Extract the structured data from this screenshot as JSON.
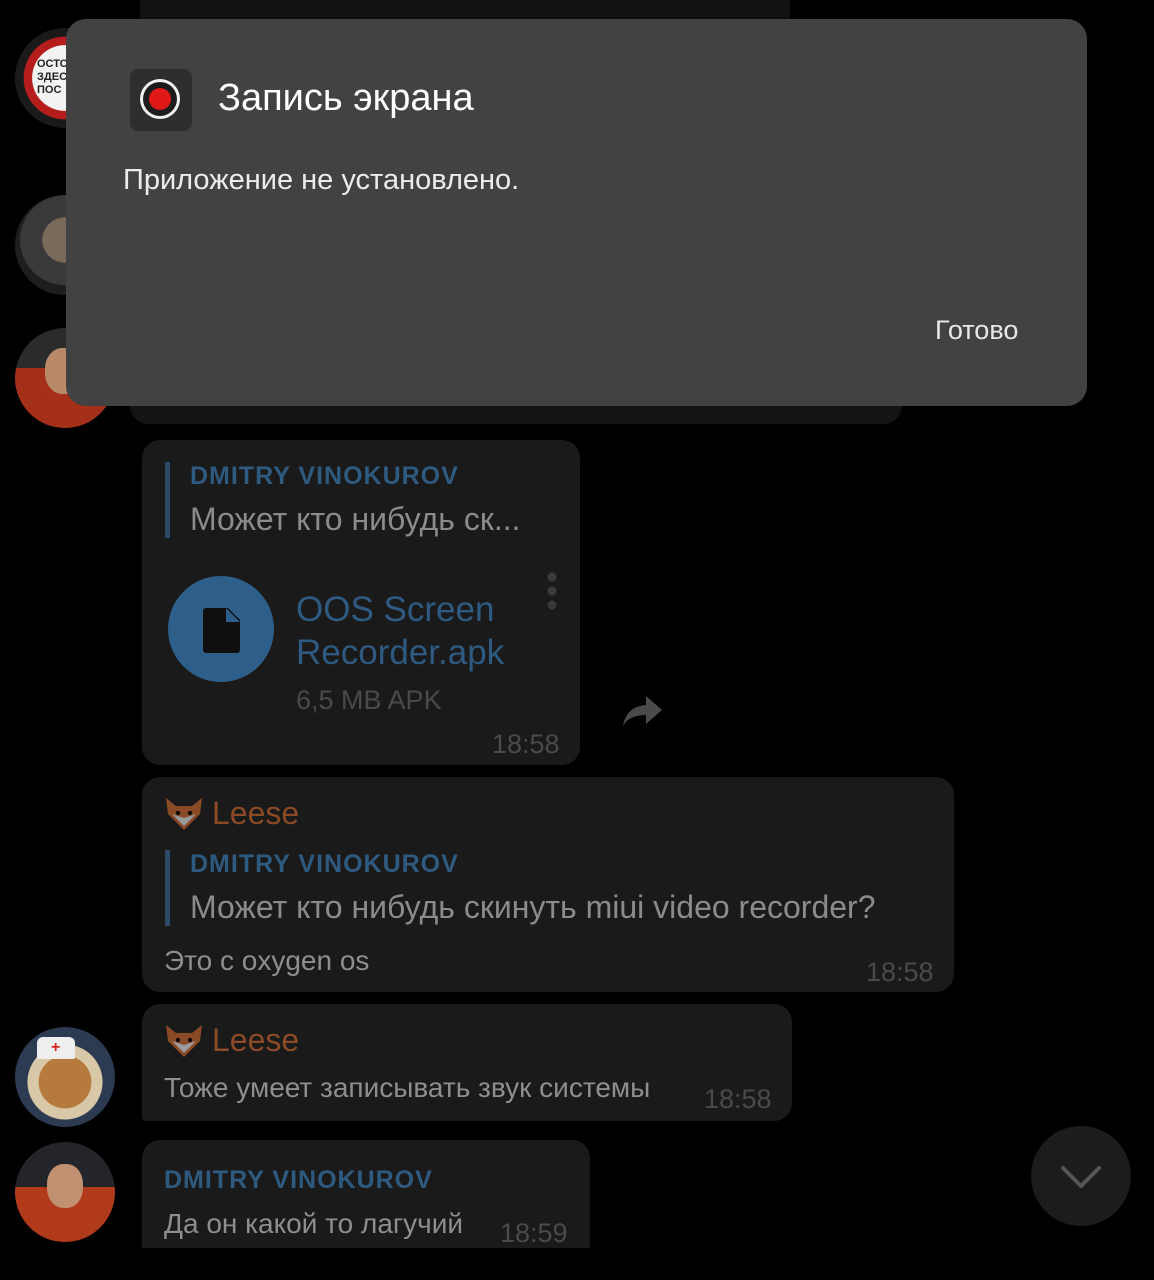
{
  "dialog": {
    "title": "Запись экрана",
    "body": "Приложение не установлено.",
    "done_button": "Готово",
    "icon": "screen-record-icon"
  },
  "messages": [
    {
      "type": "file",
      "reply": {
        "name": "DMITRY VINOKUROV",
        "text": "Может кто нибудь ск..."
      },
      "file": {
        "name_line1": "OOS Screen",
        "name_line2": "Recorder.apk",
        "meta": "6,5 MB APK",
        "icon": "file-icon"
      },
      "time": "18:58"
    },
    {
      "type": "text",
      "sender": "Leese",
      "reply": {
        "name": "DMITRY VINOKUROV",
        "text": "Может кто нибудь скинуть miui video recorder?"
      },
      "text": "Это с oxygen os",
      "time": "18:58"
    },
    {
      "type": "text",
      "sender": "Leese",
      "text": "Тоже умеет записывать звук системы",
      "time": "18:58"
    },
    {
      "type": "text",
      "sender": "DMITRY VINOKUROV",
      "text": "Да он какой то лагучий",
      "time": "18:59"
    }
  ],
  "avatar_sign_text": "ОСТО\nЗДЕСЬ\nПОС",
  "colors": {
    "dialog_bg": "#424242",
    "bubble_bg": "#1a1a1a",
    "link_blue": "#2e5a82",
    "sender_orange": "#8a4a26"
  }
}
